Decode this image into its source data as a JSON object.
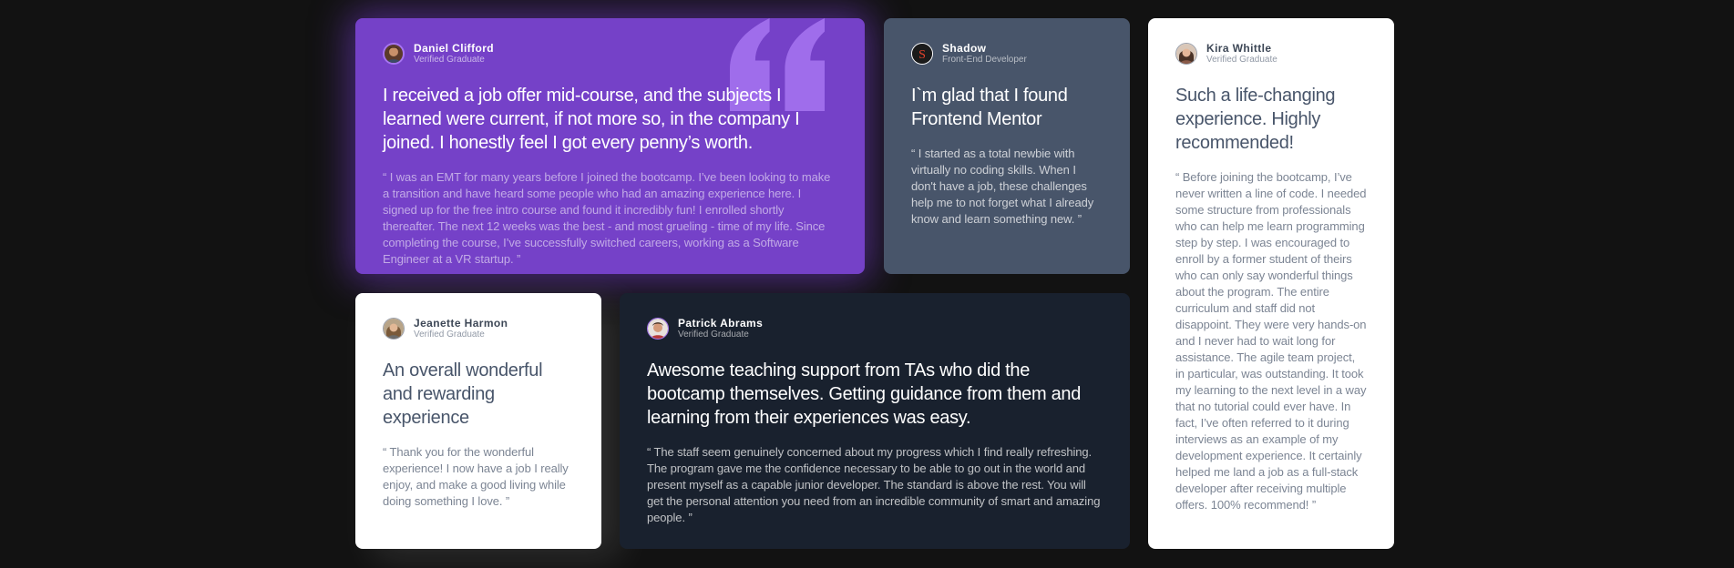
{
  "testimonials": [
    {
      "name": "Daniel Clifford",
      "role": "Verified Graduate",
      "avatar_icon": "avatar-daniel",
      "headline": "I received a job offer mid-course, and the subjects I learned were current, if not more so, in the company I joined. I honestly feel I got every penny’s worth.",
      "quote": "“ I was an EMT for many years before I joined the bootcamp. I’ve been looking to make a transition and have heard some people who had an amazing experience here. I signed up for the free intro course and found it incredibly fun! I enrolled shortly thereafter. The next 12 weeks was the best - and most grueling - time of my life. Since completing the course, I’ve successfully switched careers, working as a Software Engineer at a VR startup. ”"
    },
    {
      "name": "Shadow",
      "role": "Front-End Developer",
      "avatar_icon": "avatar-shadow",
      "headline": "I`m glad that I found Frontend Mentor",
      "quote": "“ I started as a total newbie with virtually no coding skills. When I don't have a job, these challenges help me to not forget what I already know and learn something new. ”"
    },
    {
      "name": "Kira Whittle",
      "role": "Verified Graduate",
      "avatar_icon": "avatar-kira",
      "headline": "Such a life-changing experience. Highly recommended!",
      "quote": "“ Before joining the bootcamp, I’ve never written a line of code. I needed some structure from professionals who can help me learn programming step by step. I was encouraged to enroll by a former student of theirs who can only say wonderful things about the program. The entire curriculum and staff did not disappoint. They were very hands-on and I never had to wait long for assistance. The agile team project, in particular, was outstanding. It took my learning to the next level in a way that no tutorial could ever have. In fact, I’ve often referred to it during interviews as an example of my development experience. It certainly helped me land a job as a full-stack developer after receiving multiple offers. 100% recommend! ”"
    },
    {
      "name": "Jeanette Harmon",
      "role": "Verified Graduate",
      "avatar_icon": "avatar-jeanette",
      "headline": "An overall wonderful and rewarding experience",
      "quote": "“ Thank you for the wonderful experience! I now have a job I really enjoy, and make a good living while doing something I love. ”"
    },
    {
      "name": "Patrick Abrams",
      "role": "Verified Graduate",
      "avatar_icon": "avatar-patrick",
      "headline": "Awesome teaching support from TAs who did the bootcamp themselves. Getting guidance from them and learning from their experiences was easy.",
      "quote": "“ The staff seem genuinely concerned about my progress which I find really refreshing. The program gave me the confidence necessary to be able to go out in the world and present myself as a capable junior developer. The standard is above the rest. You will get the personal attention you need from an incredible community of smart and amazing people. ”"
    }
  ],
  "colors": {
    "page_background": "#121212",
    "purple_card": "#7541c8",
    "grayish_blue_card": "#48556a",
    "dark_blue_card": "#19212e",
    "white_card": "#ffffff",
    "quote_mark": "#a775f1"
  },
  "icons": {
    "quote_mark": "quotation-mark-icon"
  }
}
